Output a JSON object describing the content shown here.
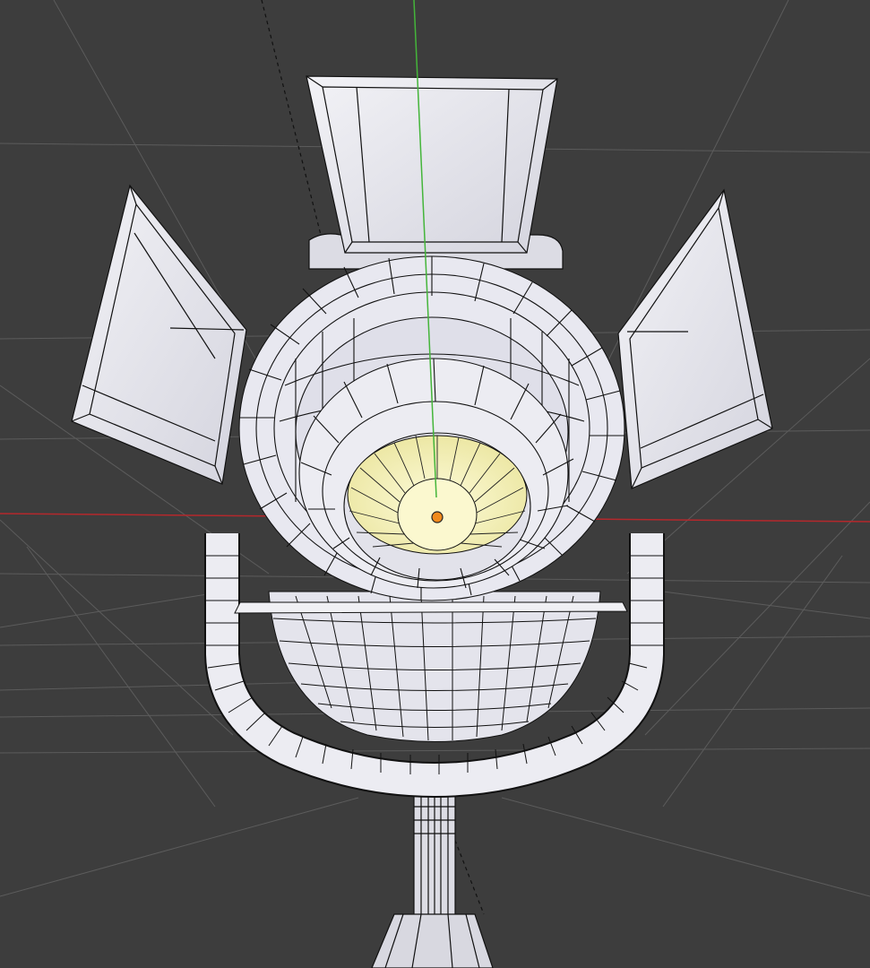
{
  "viewport": {
    "background": "#3d3d3d",
    "grid_color": "#5a5a5a",
    "x_axis_color": "#b5282c",
    "y_axis_color": "#44b53a",
    "origin_marker_color": "#f08a1c"
  },
  "model": {
    "shade": "#e6e6ee",
    "wire": "#101010",
    "lens_fill": "#f3f0b8",
    "lens_core": "#fbf8cf"
  }
}
